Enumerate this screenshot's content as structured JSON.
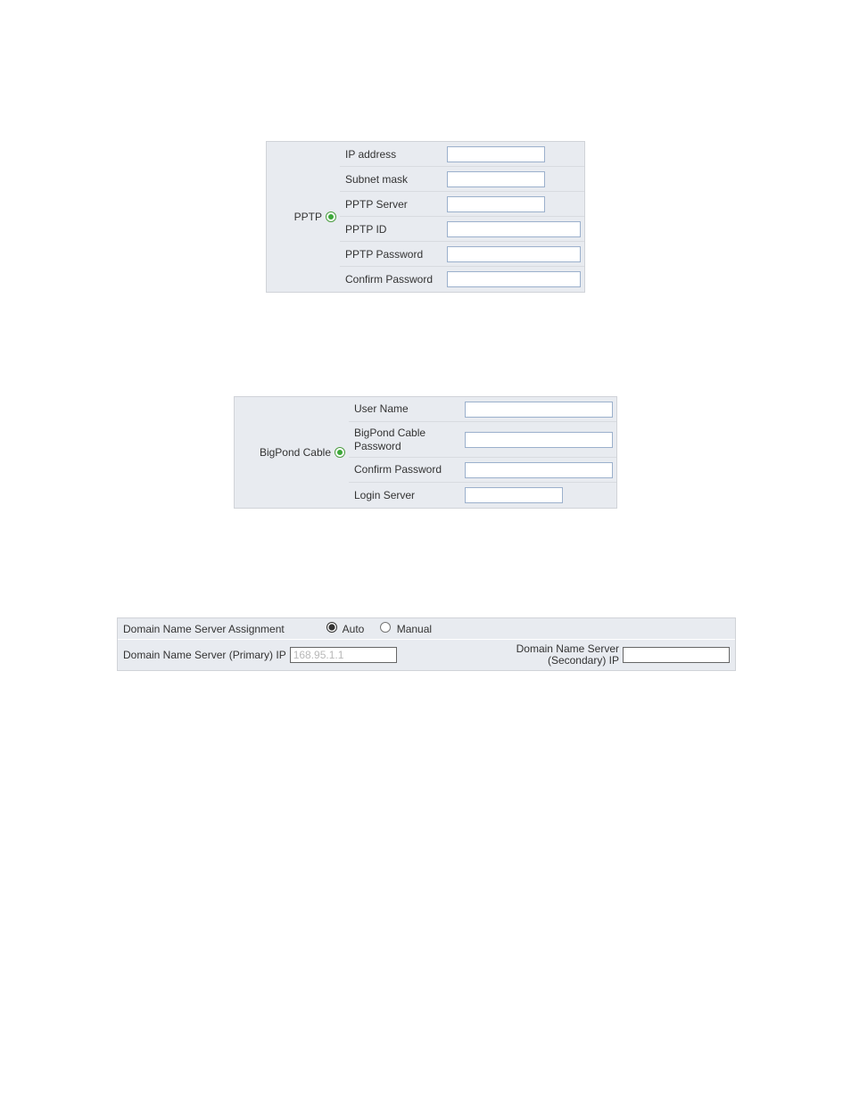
{
  "pptp": {
    "title": "PPTP",
    "fields": {
      "ip_address": {
        "label": "IP address",
        "value": ""
      },
      "subnet_mask": {
        "label": "Subnet mask",
        "value": ""
      },
      "server": {
        "label": "PPTP Server",
        "value": ""
      },
      "id": {
        "label": "PPTP ID",
        "value": ""
      },
      "password": {
        "label": "PPTP Password",
        "value": ""
      },
      "confirm": {
        "label": "Confirm Password",
        "value": ""
      }
    }
  },
  "bigpond": {
    "title": "BigPond Cable",
    "fields": {
      "username": {
        "label": "User Name",
        "value": ""
      },
      "password": {
        "label": "BigPond Cable Password",
        "value": ""
      },
      "confirm": {
        "label": "Confirm Password",
        "value": ""
      },
      "login_server": {
        "label": "Login Server",
        "value": ""
      }
    }
  },
  "dns": {
    "assignment_label": "Domain Name Server Assignment",
    "auto_label": "Auto",
    "manual_label": "Manual",
    "assignment_value": "Auto",
    "primary": {
      "label": "Domain Name Server (Primary) IP",
      "value": "168.95.1.1"
    },
    "secondary": {
      "label": "Domain Name Server (Secondary) IP",
      "value": ""
    }
  }
}
